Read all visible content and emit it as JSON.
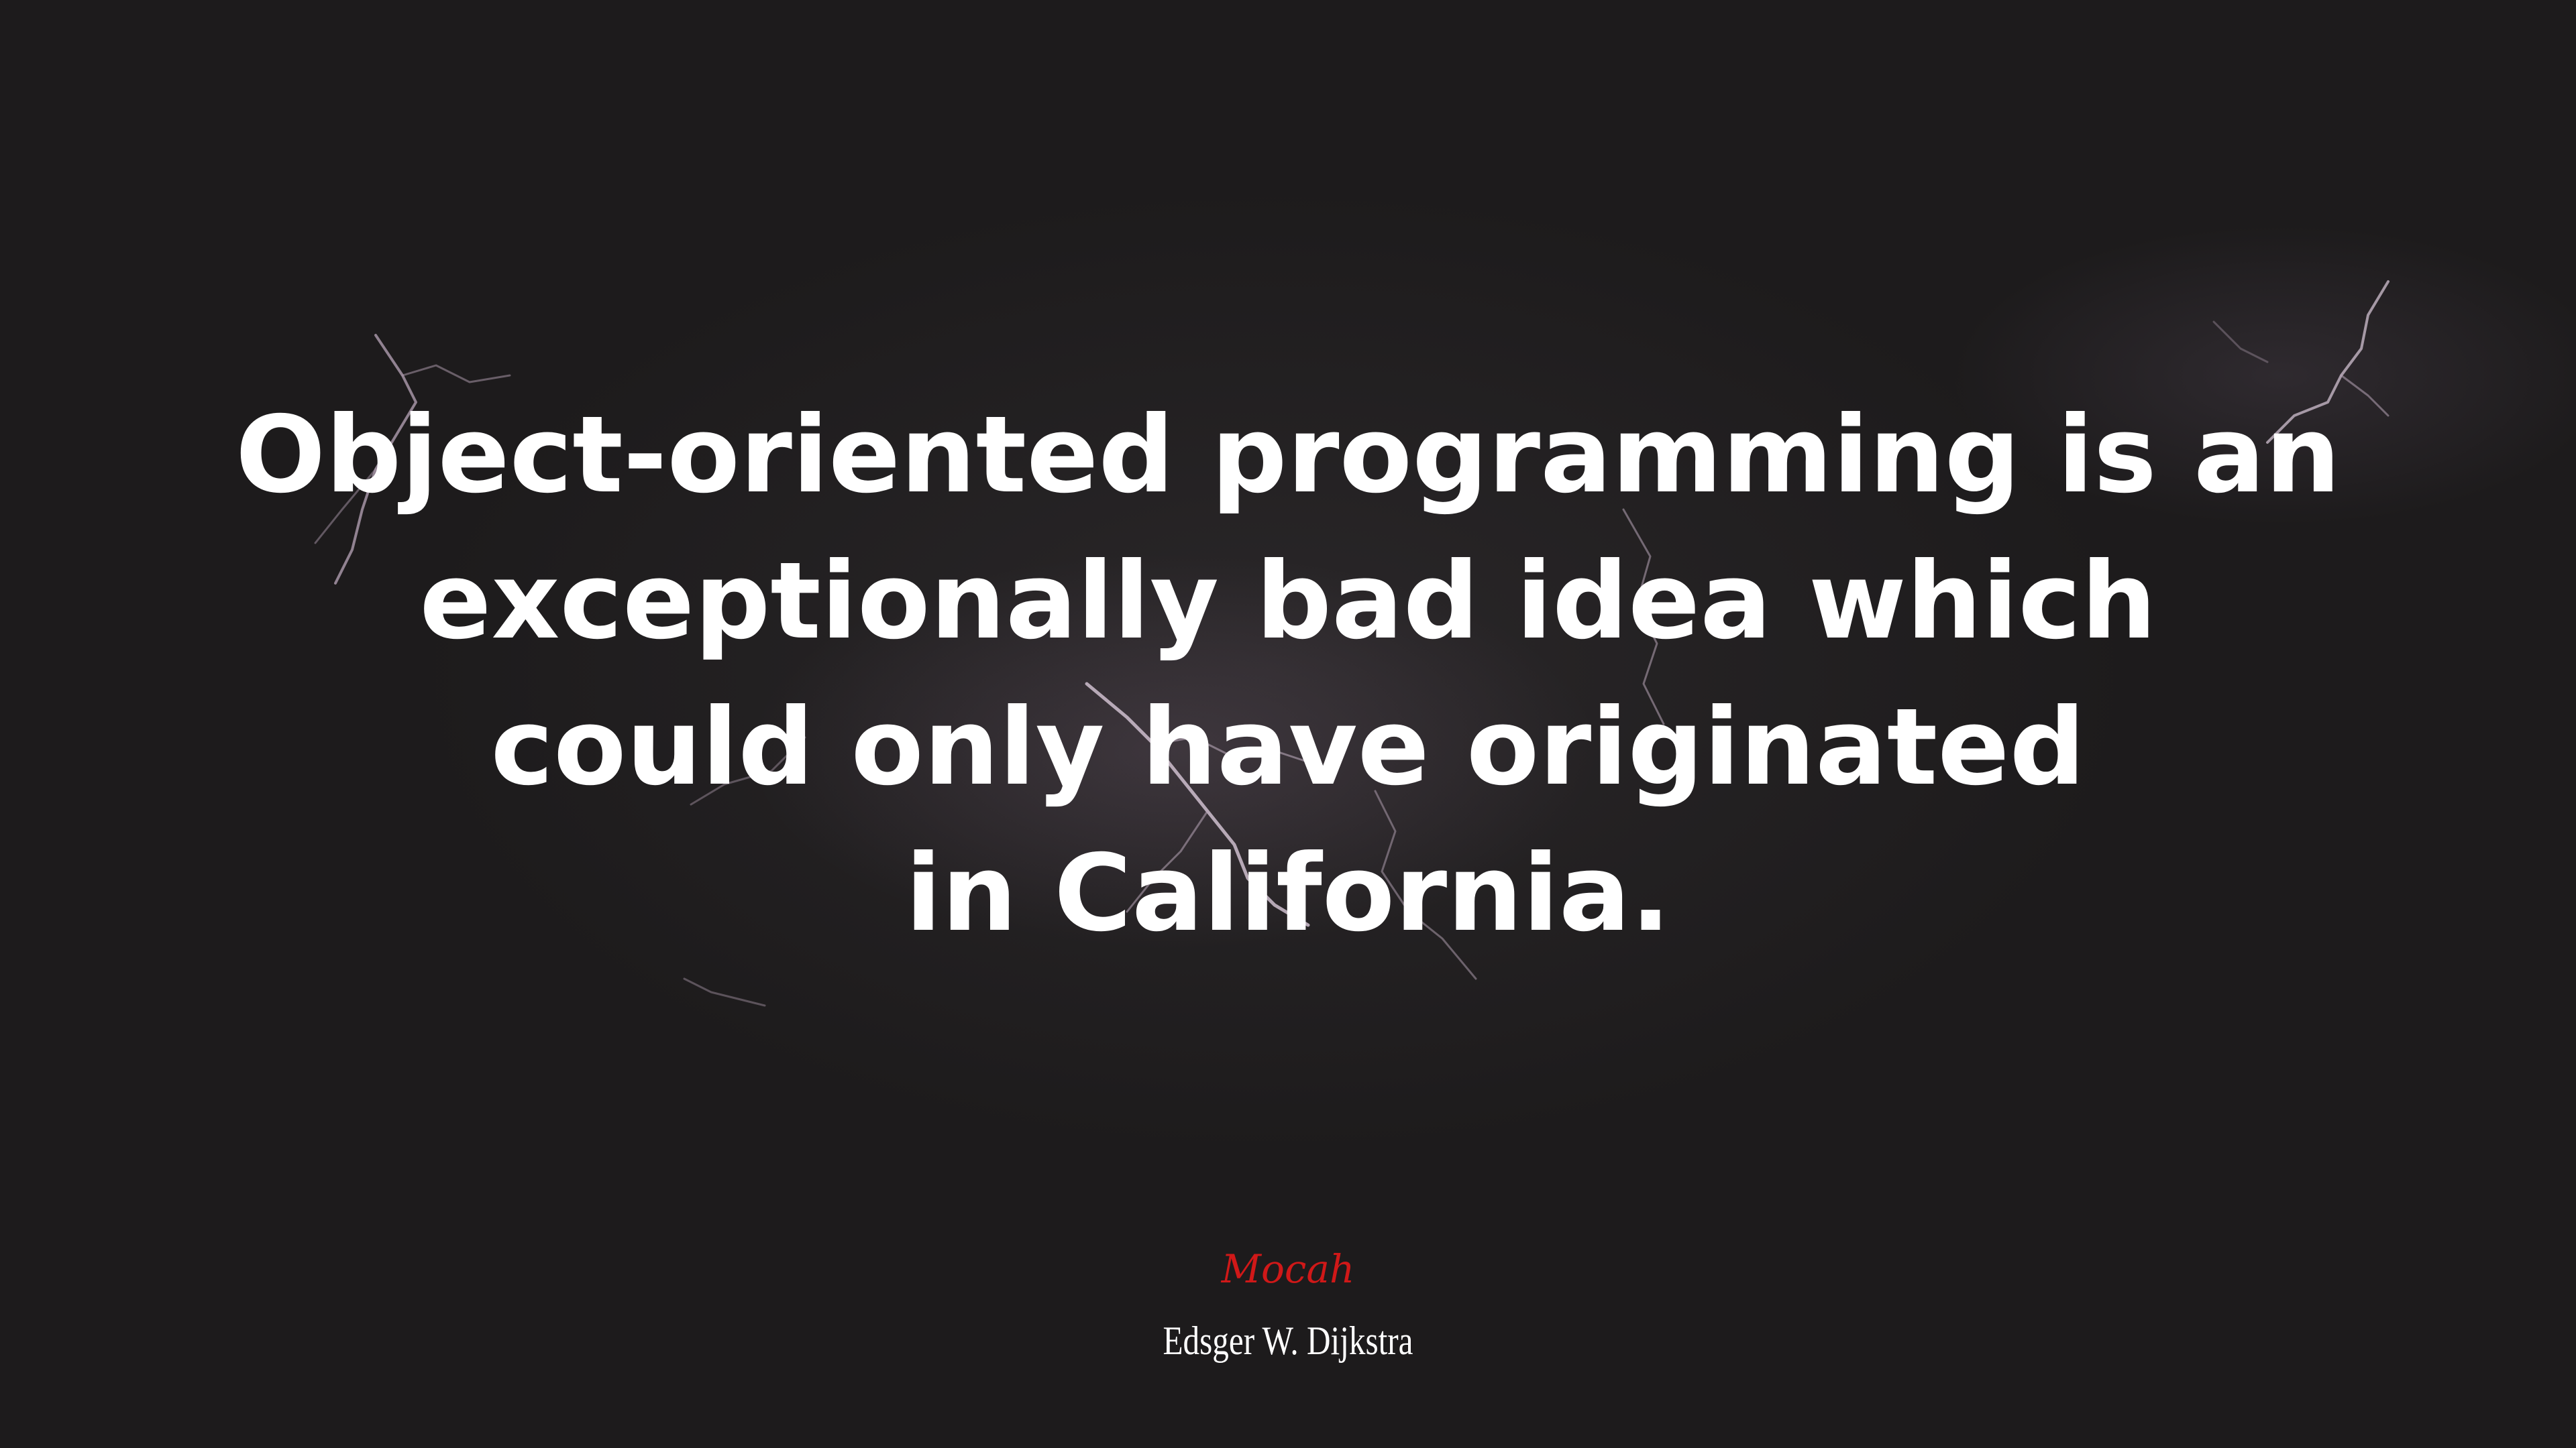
{
  "quote": {
    "lines": [
      "Object-oriented programming is an",
      "exceptionally bad idea which",
      "could only have originated",
      "in California."
    ]
  },
  "brand": {
    "text": "Mocah",
    "color": "#d01818"
  },
  "author": {
    "name": "Edsger W. Dijkstra"
  },
  "background": {
    "description_colors": {
      "base": "#1e1c1d",
      "glow": "#7a6478",
      "bolt": "#c9b8c8"
    }
  }
}
